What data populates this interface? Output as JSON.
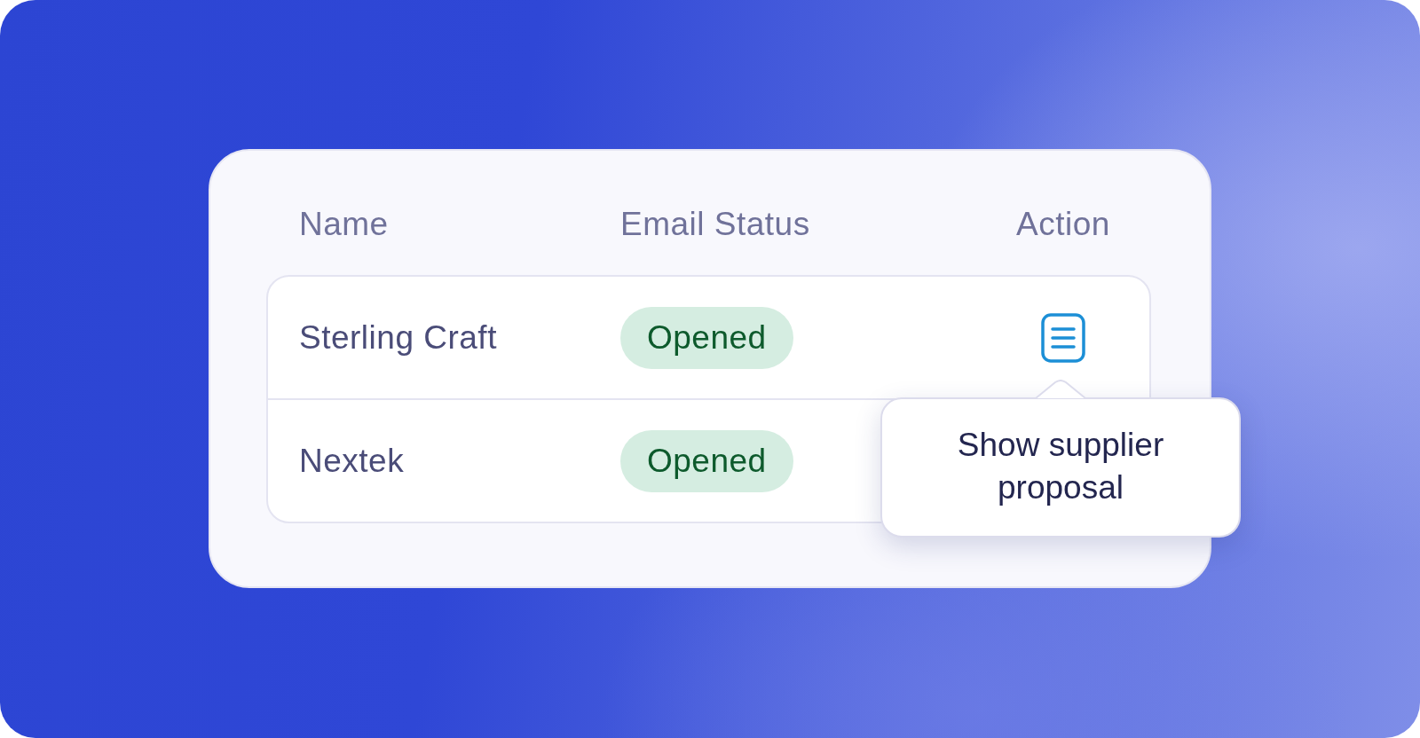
{
  "table": {
    "columns": [
      "Name",
      "Email Status",
      "Action"
    ],
    "rows": [
      {
        "name": "Sterling Craft",
        "email_status": "Opened",
        "action": {
          "kind": "document"
        }
      },
      {
        "name": "Nextek",
        "email_status": "Opened"
      }
    ]
  },
  "tooltip": {
    "text": "Show supplier proposal"
  }
}
